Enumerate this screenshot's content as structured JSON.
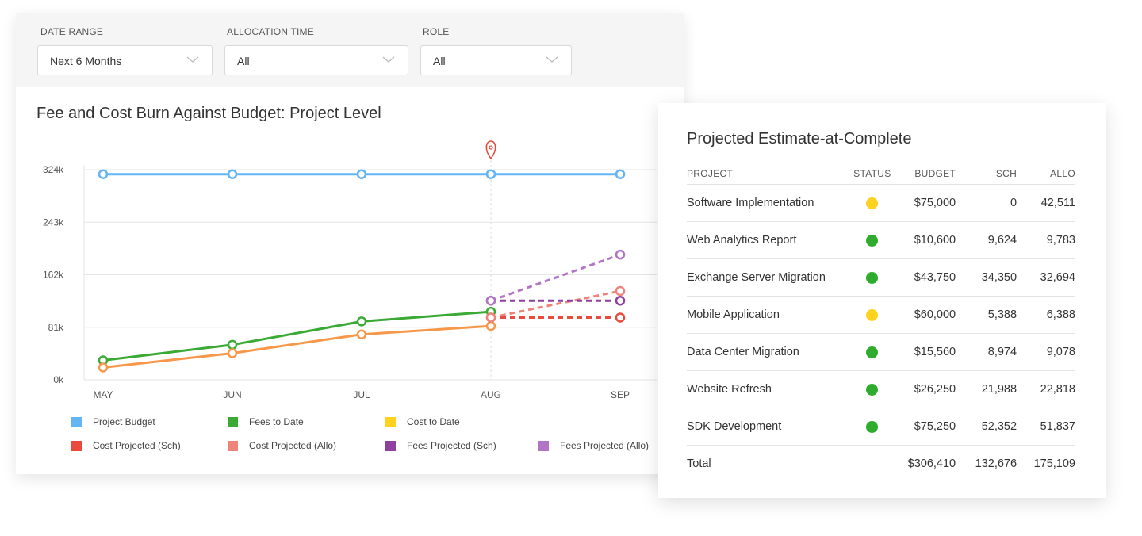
{
  "filters": [
    {
      "label": "DATE RANGE",
      "value": "Next 6 Months"
    },
    {
      "label": "ALLOCATION TIME",
      "value": "All"
    },
    {
      "label": "ROLE",
      "value": "All"
    }
  ],
  "colors": {
    "project_budget": "#64b5f6",
    "fees_to_date": "#3aaa35",
    "cost_to_date": "#ffd21f",
    "cost_projected_sch": "#e84a3c",
    "cost_projected_allo": "#ee837b",
    "fees_projected_sch": "#8e3fa0",
    "fees_projected_allo": "#b374c6",
    "cost_line": "#f7974a",
    "status_green": "#2eac2e",
    "status_yellow": "#ffd21f"
  },
  "chart_data": {
    "type": "line",
    "title": "Fee and Cost Burn Against Budget: Project Level",
    "categories": [
      "MAY",
      "JUN",
      "JUL",
      "AUG",
      "SEP"
    ],
    "y_ticks": [
      "0k",
      "81k",
      "162k",
      "243k",
      "324k"
    ],
    "ylim": [
      0,
      324
    ],
    "grid": true,
    "legend_position": "bottom",
    "marker_category": "AUG",
    "series": [
      {
        "name": "Project Budget",
        "color_key": "project_budget",
        "style": "solid",
        "x": [
          "MAY",
          "JUN",
          "JUL",
          "AUG",
          "SEP"
        ],
        "values": [
          317,
          317,
          317,
          317,
          317
        ]
      },
      {
        "name": "Fees to Date",
        "color_key": "fees_to_date",
        "style": "solid",
        "x": [
          "MAY",
          "JUN",
          "JUL",
          "AUG"
        ],
        "values": [
          30,
          54,
          90,
          105
        ]
      },
      {
        "name": "Cost to Date",
        "color_key": "cost_line",
        "style": "solid",
        "x": [
          "MAY",
          "JUN",
          "JUL",
          "AUG"
        ],
        "values": [
          19,
          41,
          70,
          83
        ]
      },
      {
        "name": "Cost Projected (Sch)",
        "color_key": "cost_projected_sch",
        "style": "dashed",
        "x": [
          "AUG",
          "SEP"
        ],
        "values": [
          96,
          96
        ]
      },
      {
        "name": "Cost Projected (Allo)",
        "color_key": "cost_projected_allo",
        "style": "dashed",
        "x": [
          "AUG",
          "SEP"
        ],
        "values": [
          96,
          137
        ]
      },
      {
        "name": "Fees Projected (Sch)",
        "color_key": "fees_projected_sch",
        "style": "dashed",
        "x": [
          "AUG",
          "SEP"
        ],
        "values": [
          122,
          122
        ]
      },
      {
        "name": "Fees Projected (Allo)",
        "color_key": "fees_projected_allo",
        "style": "dashed",
        "x": [
          "AUG",
          "SEP"
        ],
        "values": [
          122,
          193
        ]
      }
    ],
    "legend": [
      {
        "label": "Project Budget",
        "color_key": "project_budget"
      },
      {
        "label": "Fees to Date",
        "color_key": "fees_to_date"
      },
      {
        "label": "Cost to Date",
        "color_key": "cost_to_date"
      },
      {
        "label": "Cost Projected (Sch)",
        "color_key": "cost_projected_sch"
      },
      {
        "label": "Cost Projected (Allo)",
        "color_key": "cost_projected_allo"
      },
      {
        "label": "Fees Projected (Sch)",
        "color_key": "fees_projected_sch"
      },
      {
        "label": "Fees Projected (Allo)",
        "color_key": "fees_projected_allo"
      }
    ]
  },
  "eac": {
    "title": "Projected Estimate-at-Complete",
    "columns": [
      "PROJECT",
      "STATUS",
      "BUDGET",
      "SCH",
      "ALLO"
    ],
    "rows": [
      {
        "project": "Software Implementation",
        "status": "yellow",
        "budget": "$75,000",
        "sch": "0",
        "allo": "42,511"
      },
      {
        "project": "Web Analytics Report",
        "status": "green",
        "budget": "$10,600",
        "sch": "9,624",
        "allo": "9,783"
      },
      {
        "project": "Exchange Server Migration",
        "status": "green",
        "budget": "$43,750",
        "sch": "34,350",
        "allo": "32,694"
      },
      {
        "project": "Mobile Application",
        "status": "yellow",
        "budget": "$60,000",
        "sch": "5,388",
        "allo": "6,388"
      },
      {
        "project": "Data Center Migration",
        "status": "green",
        "budget": "$15,560",
        "sch": "8,974",
        "allo": "9,078"
      },
      {
        "project": "Website Refresh",
        "status": "green",
        "budget": "$26,250",
        "sch": "21,988",
        "allo": "22,818"
      },
      {
        "project": "SDK Development",
        "status": "green",
        "budget": "$75,250",
        "sch": "52,352",
        "allo": "51,837"
      }
    ],
    "total": {
      "label": "Total",
      "budget": "$306,410",
      "sch": "132,676",
      "allo": "175,109"
    }
  }
}
